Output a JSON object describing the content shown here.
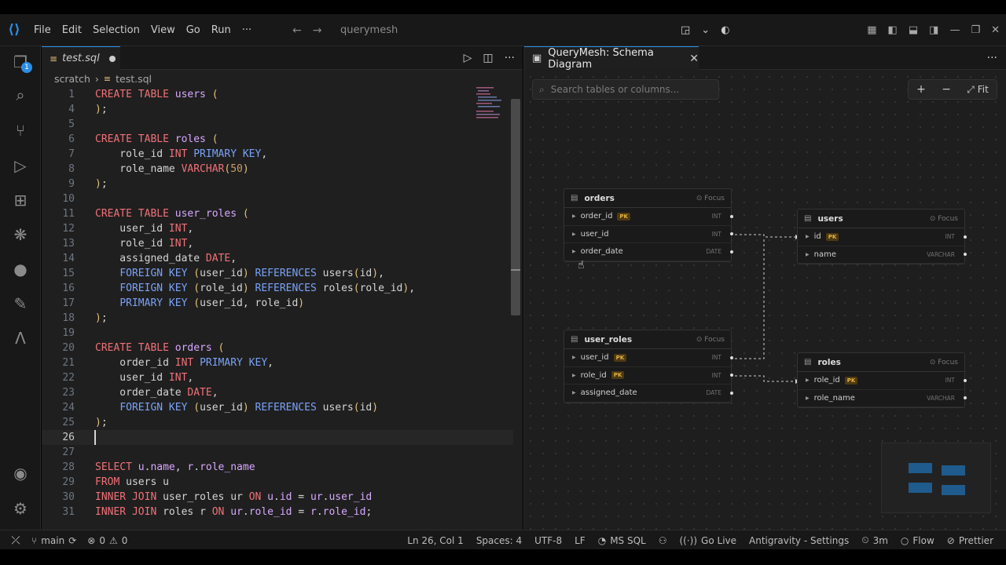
{
  "menu": [
    "File",
    "Edit",
    "Selection",
    "View",
    "Go",
    "Run",
    "···"
  ],
  "title_search": "querymesh",
  "activity_badge": "1",
  "editor": {
    "tab_name": "test.sql",
    "breadcrumb": [
      "scratch",
      "test.sql"
    ],
    "lines": [
      {
        "n": "1",
        "html": "<span class='kw'>CREATE TABLE</span> <span class='id'>users</span> <span class='pu'>(</span>"
      },
      {
        "n": "4",
        "html": "<span class='pu'>)</span>;"
      },
      {
        "n": "5",
        "html": ""
      },
      {
        "n": "6",
        "html": "<span class='kw'>CREATE TABLE</span> <span class='id'>roles</span> <span class='pu'>(</span>"
      },
      {
        "n": "7",
        "html": "    role_id <span class='ty'>INT</span> <span class='fn'>PRIMARY KEY</span>,"
      },
      {
        "n": "8",
        "html": "    role_name <span class='ty'>VARCHAR</span><span class='pu'>(</span><span class='nu'>50</span><span class='pu'>)</span>"
      },
      {
        "n": "9",
        "html": "<span class='pu'>)</span>;"
      },
      {
        "n": "10",
        "html": ""
      },
      {
        "n": "11",
        "html": "<span class='kw'>CREATE TABLE</span> <span class='id'>user_roles</span> <span class='pu'>(</span>"
      },
      {
        "n": "12",
        "html": "    user_id <span class='ty'>INT</span>,"
      },
      {
        "n": "13",
        "html": "    role_id <span class='ty'>INT</span>,"
      },
      {
        "n": "14",
        "html": "    assigned_date <span class='ty'>DATE</span>,"
      },
      {
        "n": "15",
        "html": "    <span class='fn'>FOREIGN KEY</span> <span class='pu'>(</span>user_id<span class='pu'>)</span> <span class='fn'>REFERENCES</span> users<span class='pu'>(</span>id<span class='pu'>)</span>,"
      },
      {
        "n": "16",
        "html": "    <span class='fn'>FOREIGN KEY</span> <span class='pu'>(</span>role_id<span class='pu'>)</span> <span class='fn'>REFERENCES</span> roles<span class='pu'>(</span>role_id<span class='pu'>)</span>,"
      },
      {
        "n": "17",
        "html": "    <span class='fn'>PRIMARY KEY</span> <span class='pu'>(</span>user_id, role_id<span class='pu'>)</span>"
      },
      {
        "n": "18",
        "html": "<span class='pu'>)</span>;"
      },
      {
        "n": "19",
        "html": ""
      },
      {
        "n": "20",
        "html": "<span class='kw'>CREATE TABLE</span> <span class='id'>orders</span> <span class='pu'>(</span>"
      },
      {
        "n": "21",
        "html": "    order_id <span class='ty'>INT</span> <span class='fn'>PRIMARY KEY</span>,"
      },
      {
        "n": "22",
        "html": "    user_id <span class='ty'>INT</span>,"
      },
      {
        "n": "23",
        "html": "    order_date <span class='ty'>DATE</span>,"
      },
      {
        "n": "24",
        "html": "    <span class='fn'>FOREIGN KEY</span> <span class='pu'>(</span>user_id<span class='pu'>)</span> <span class='fn'>REFERENCES</span> users<span class='pu'>(</span>id<span class='pu'>)</span>"
      },
      {
        "n": "25",
        "html": "<span class='pu'>)</span>;"
      },
      {
        "n": "26",
        "html": "",
        "current": true
      },
      {
        "n": "27",
        "html": ""
      },
      {
        "n": "28",
        "html": "<span class='kw'>SELECT</span> <span class='id'>u</span>.<span class='id'>name</span>, <span class='id'>r</span>.<span class='id'>role_name</span>"
      },
      {
        "n": "29",
        "html": "<span class='kw'>FROM</span> users u"
      },
      {
        "n": "30",
        "html": "<span class='kw'>INNER JOIN</span> user_roles ur <span class='kw'>ON</span> <span class='id'>u</span>.<span class='id'>id</span> = <span class='id'>ur</span>.<span class='id'>user_id</span>"
      },
      {
        "n": "31",
        "html": "<span class='kw'>INNER JOIN</span> roles r <span class='kw'>ON</span> <span class='id'>ur</span>.<span class='id'>role_id</span> = <span class='id'>r</span>.<span class='id'>role_id</span>;"
      }
    ]
  },
  "panel": {
    "tab_name": "QueryMesh: Schema Diagram",
    "search_placeholder": "Search tables or columns...",
    "zoom_in": "+",
    "zoom_out": "−",
    "fit_label": "Fit",
    "focus_label": "Focus",
    "tables": {
      "orders": {
        "name": "orders",
        "columns": [
          {
            "name": "order_id",
            "pk": "PK",
            "type": "INT"
          },
          {
            "name": "user_id",
            "pk": "",
            "type": "INT"
          },
          {
            "name": "order_date",
            "pk": "",
            "type": "DATE"
          }
        ]
      },
      "users": {
        "name": "users",
        "columns": [
          {
            "name": "id",
            "pk": "PK",
            "type": "INT"
          },
          {
            "name": "name",
            "pk": "",
            "type": "VARCHAR"
          }
        ]
      },
      "user_roles": {
        "name": "user_roles",
        "columns": [
          {
            "name": "user_id",
            "pk": "PK",
            "type": "INT"
          },
          {
            "name": "role_id",
            "pk": "PK",
            "type": "INT"
          },
          {
            "name": "assigned_date",
            "pk": "",
            "type": "DATE"
          }
        ]
      },
      "roles": {
        "name": "roles",
        "columns": [
          {
            "name": "role_id",
            "pk": "PK",
            "type": "INT"
          },
          {
            "name": "role_name",
            "pk": "",
            "type": "VARCHAR"
          }
        ]
      }
    }
  },
  "status": {
    "branch": "main",
    "errors": "0",
    "warnings": "0",
    "position": "Ln 26, Col 1",
    "spaces": "Spaces: 4",
    "encoding": "UTF-8",
    "eol": "LF",
    "language": "MS SQL",
    "golive": "Go Live",
    "settings": "Antigravity - Settings",
    "time": "3m",
    "flow": "Flow",
    "prettier": "Prettier"
  },
  "colors": {
    "accent": "#2a8ee6",
    "pk_badge": "#e3b341"
  }
}
